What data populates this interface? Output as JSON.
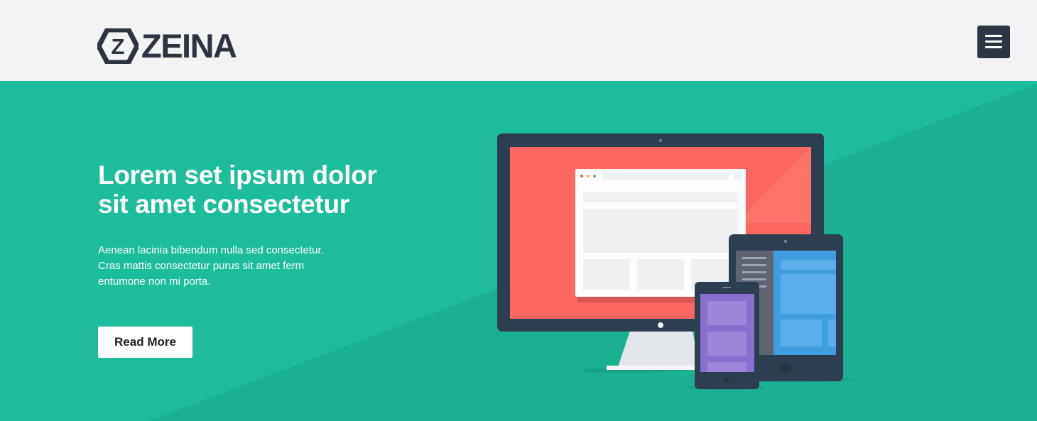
{
  "brand": {
    "name": "ZEINA",
    "mark_letter": "Z"
  },
  "header": {
    "menu_icon": "hamburger-icon"
  },
  "hero": {
    "title_line1": "Lorem set ipsum dolor",
    "title_line2": "sit amet consectetur",
    "body_line1": "Aenean lacinia bibendum nulla sed consectetur.",
    "body_line2": "Cras mattis consectetur purus sit amet ferm",
    "body_line3": "entumone non mi porta.",
    "cta_label": "Read More"
  },
  "colors": {
    "header_bg": "#f3f3f3",
    "brand_dark": "#2b3440",
    "hero_bg": "#1dbc9b",
    "hero_bg_dark": "#1ab090",
    "monitor_screen": "#fe6660",
    "tablet_screen": "#3f9ee0",
    "phone_screen": "#8a6fd1"
  },
  "illustration": {
    "icon": "responsive-devices-illustration"
  }
}
